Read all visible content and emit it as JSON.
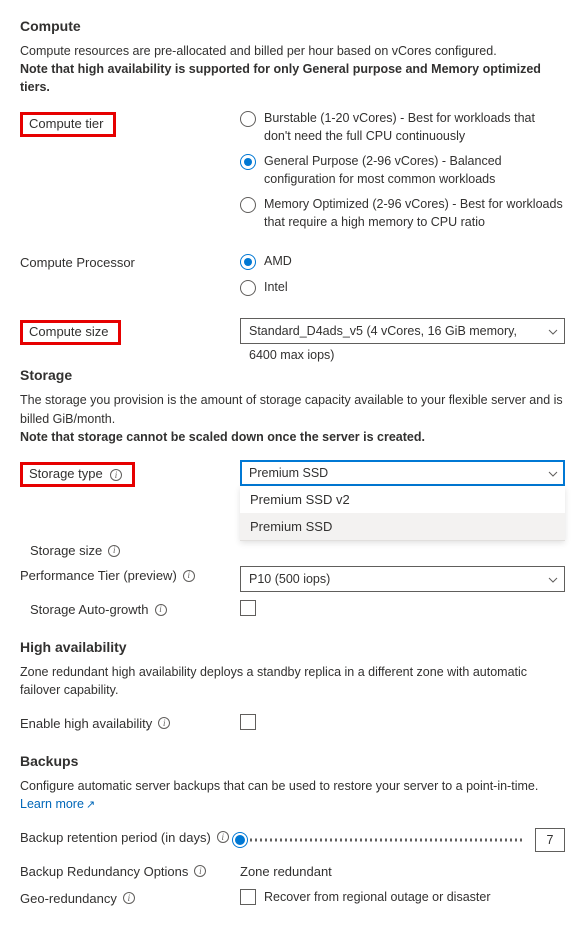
{
  "compute": {
    "heading": "Compute",
    "desc_line1": "Compute resources are pre-allocated and billed per hour based on vCores configured.",
    "desc_line2": "Note that high availability is supported for only General purpose and Memory optimized tiers.",
    "tier_label": "Compute tier",
    "tiers": [
      "Burstable (1-20 vCores) - Best for workloads that don't need the full CPU continuously",
      "General Purpose (2-96 vCores) - Balanced configuration for most common workloads",
      "Memory Optimized (2-96 vCores) - Best for workloads that require a high memory to CPU ratio"
    ],
    "processor_label": "Compute Processor",
    "processors": [
      "AMD",
      "Intel"
    ],
    "size_label": "Compute size",
    "size_value": "Standard_D4ads_v5 (4 vCores, 16 GiB memory, 6400 max iops)"
  },
  "storage": {
    "heading": "Storage",
    "desc_line1": "The storage you provision is the amount of storage capacity available to your flexible server and is billed GiB/month.",
    "desc_line2": "Note that storage cannot be scaled down once the server is created.",
    "type_label": "Storage type",
    "type_value": "Premium SSD",
    "type_options": [
      "Premium SSD v2",
      "Premium SSD"
    ],
    "size_label": "Storage size",
    "perf_label": "Performance Tier (preview)",
    "perf_value": "P10 (500 iops)",
    "autogrowth_label": "Storage Auto-growth"
  },
  "ha": {
    "heading": "High availability",
    "desc": "Zone redundant high availability deploys a standby replica in a different zone with automatic failover capability.",
    "enable_label": "Enable high availability"
  },
  "backups": {
    "heading": "Backups",
    "desc": "Configure automatic server backups that can be used to restore your server to a point-in-time. ",
    "learn_more": "Learn more",
    "retention_label": "Backup retention period (in days)",
    "retention_value": "7",
    "redundancy_label": "Backup Redundancy Options",
    "redundancy_value": "Zone redundant",
    "geo_label": "Geo-redundancy",
    "geo_checkbox_label": "Recover from regional outage or disaster"
  }
}
